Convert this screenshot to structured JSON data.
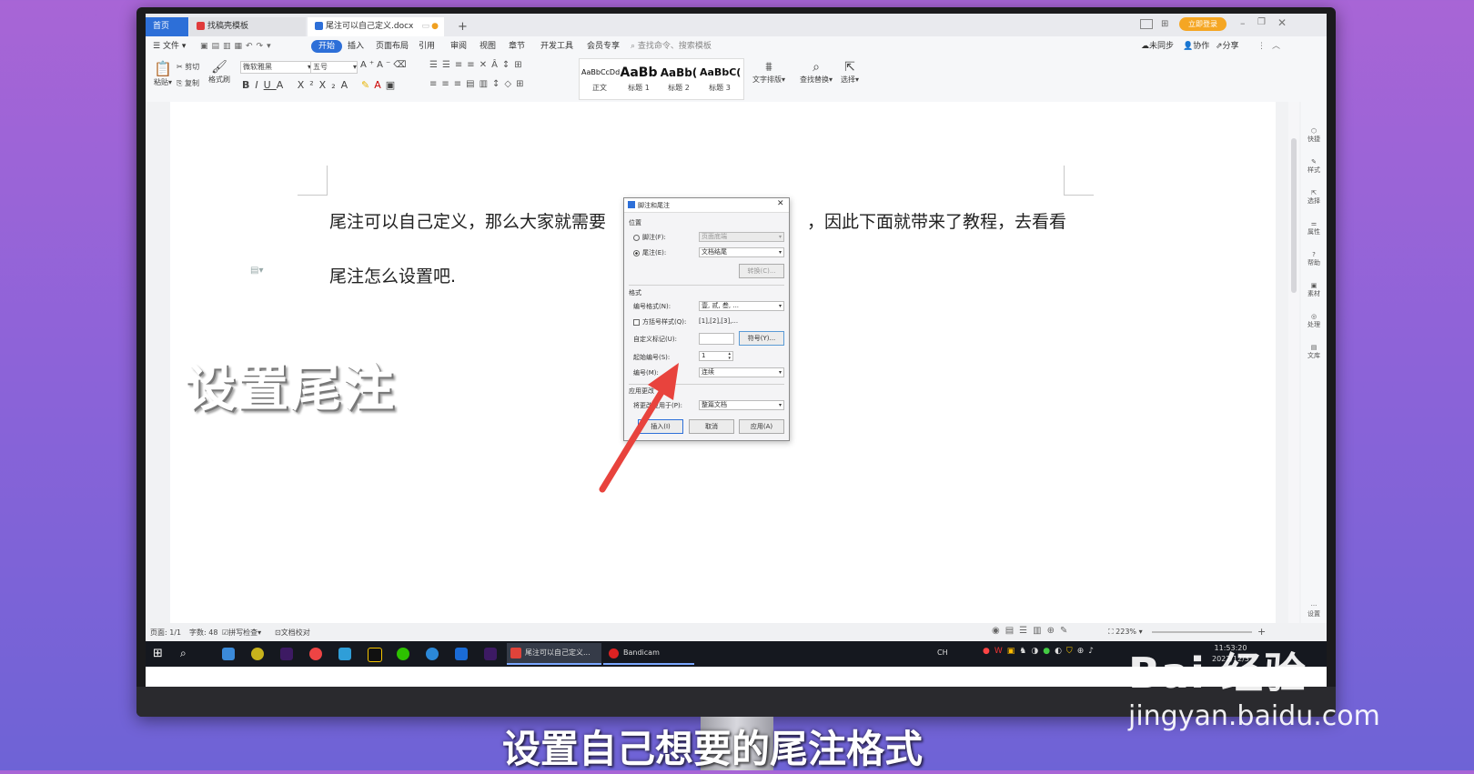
{
  "tabs": {
    "home": "首页",
    "templates": "找稿壳模板",
    "document": "尾注可以自己定义.docx",
    "new_tab": "+"
  },
  "titlebar": {
    "login": "立即登录"
  },
  "menu": {
    "file": "文件",
    "items": [
      "开始",
      "插入",
      "页面布局",
      "引用",
      "审阅",
      "视图",
      "章节",
      "开发工具",
      "会员专享"
    ],
    "search": "查找命令、搜索模板",
    "right": [
      "未同步",
      "协作",
      "分享"
    ]
  },
  "ribbon": {
    "paste": "粘贴",
    "cut": "剪切",
    "copy": "复制",
    "format_painter": "格式刷",
    "font": "微软雅黑",
    "size": "五号",
    "styles": [
      {
        "sample": "AaBbCcDd",
        "label": "正文"
      },
      {
        "sample": "AaBb",
        "label": "标题 1"
      },
      {
        "sample": "AaBb(",
        "label": "标题 2"
      },
      {
        "sample": "AaBbC(",
        "label": "标题 3"
      }
    ],
    "text_layout": "文字排版",
    "find_replace": "查找替换",
    "select": "选择"
  },
  "document": {
    "line1": "尾注可以自己定义，那么大家就需要",
    "line1b": "，因此下面就带来了教程，去看看",
    "line2": "尾注怎么设置吧."
  },
  "side": [
    "快捷",
    "样式",
    "选择",
    "属性",
    "帮助",
    "素材",
    "处理",
    "文库",
    "设置"
  ],
  "status": {
    "page": "页面: 1/1",
    "words": "字数: 48",
    "spell": "拼写检查",
    "proof": "文档校对",
    "zoom": "223%"
  },
  "taskbar": {
    "app1": "尾注可以自己定义...",
    "app2": "Bandicam",
    "time": "11:53:20",
    "date": "2022/12/3",
    "ime": "CH"
  },
  "dialog": {
    "title": "脚注和尾注",
    "position": "位置",
    "footnote": "脚注(F):",
    "footnote_val": "页面底端",
    "endnote": "尾注(E):",
    "endnote_val": "文档结尾",
    "convert": "转换(C)...",
    "format": "格式",
    "numfmt": "编号格式(N):",
    "numfmt_val": "壹, 贰, 叁, ...",
    "bracket": "方括号样式(Q):",
    "bracket_val": "[1],[2],[3],...",
    "custom": "自定义标记(U):",
    "symbol": "符号(Y)...",
    "start": "起始编号(S):",
    "start_val": "1",
    "numbering": "编号(M):",
    "numbering_val": "连续",
    "apply": "应用更改",
    "apply_to": "将更改应用于(P):",
    "apply_to_val": "整篇文档",
    "insert": "插入(I)",
    "cancel": "取消",
    "apply_btn": "应用(A)"
  },
  "overlay": {
    "caption": "设置尾注",
    "subtitle": "设置自己想要的尾注格式",
    "watermark": "Bai 经验",
    "watermark_url": "jingyan.baidu.com"
  },
  "colors": {
    "accent": "#2d6fd8",
    "arrow": "#e8433d"
  }
}
